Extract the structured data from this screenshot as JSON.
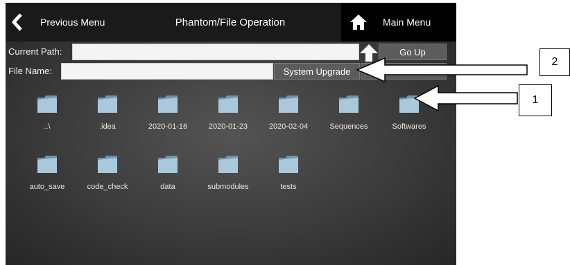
{
  "header": {
    "prev_label": "Previous Menu",
    "title": "Phantom/File Operation",
    "main_label": "Main Menu"
  },
  "path_row": {
    "label": "Current Path:",
    "value": "",
    "go_up_label": "Go Up"
  },
  "file_row": {
    "label": "File Name:",
    "value": "",
    "upgrade_label": "System Upgrade"
  },
  "folders": [
    "..\\",
    ".idea",
    "2020-01-16",
    "2020-01-23",
    "2020-02-04",
    "Sequences",
    "Softwares",
    "auto_save",
    "code_check",
    "data",
    "submodules",
    "tests"
  ],
  "callouts": {
    "one": "1",
    "two": "2"
  },
  "colors": {
    "header_bg": "#1a1a1a",
    "screen_bg": "#3b3b3b",
    "folder": "#8fb3cc",
    "accent_text": "#ffffff"
  }
}
